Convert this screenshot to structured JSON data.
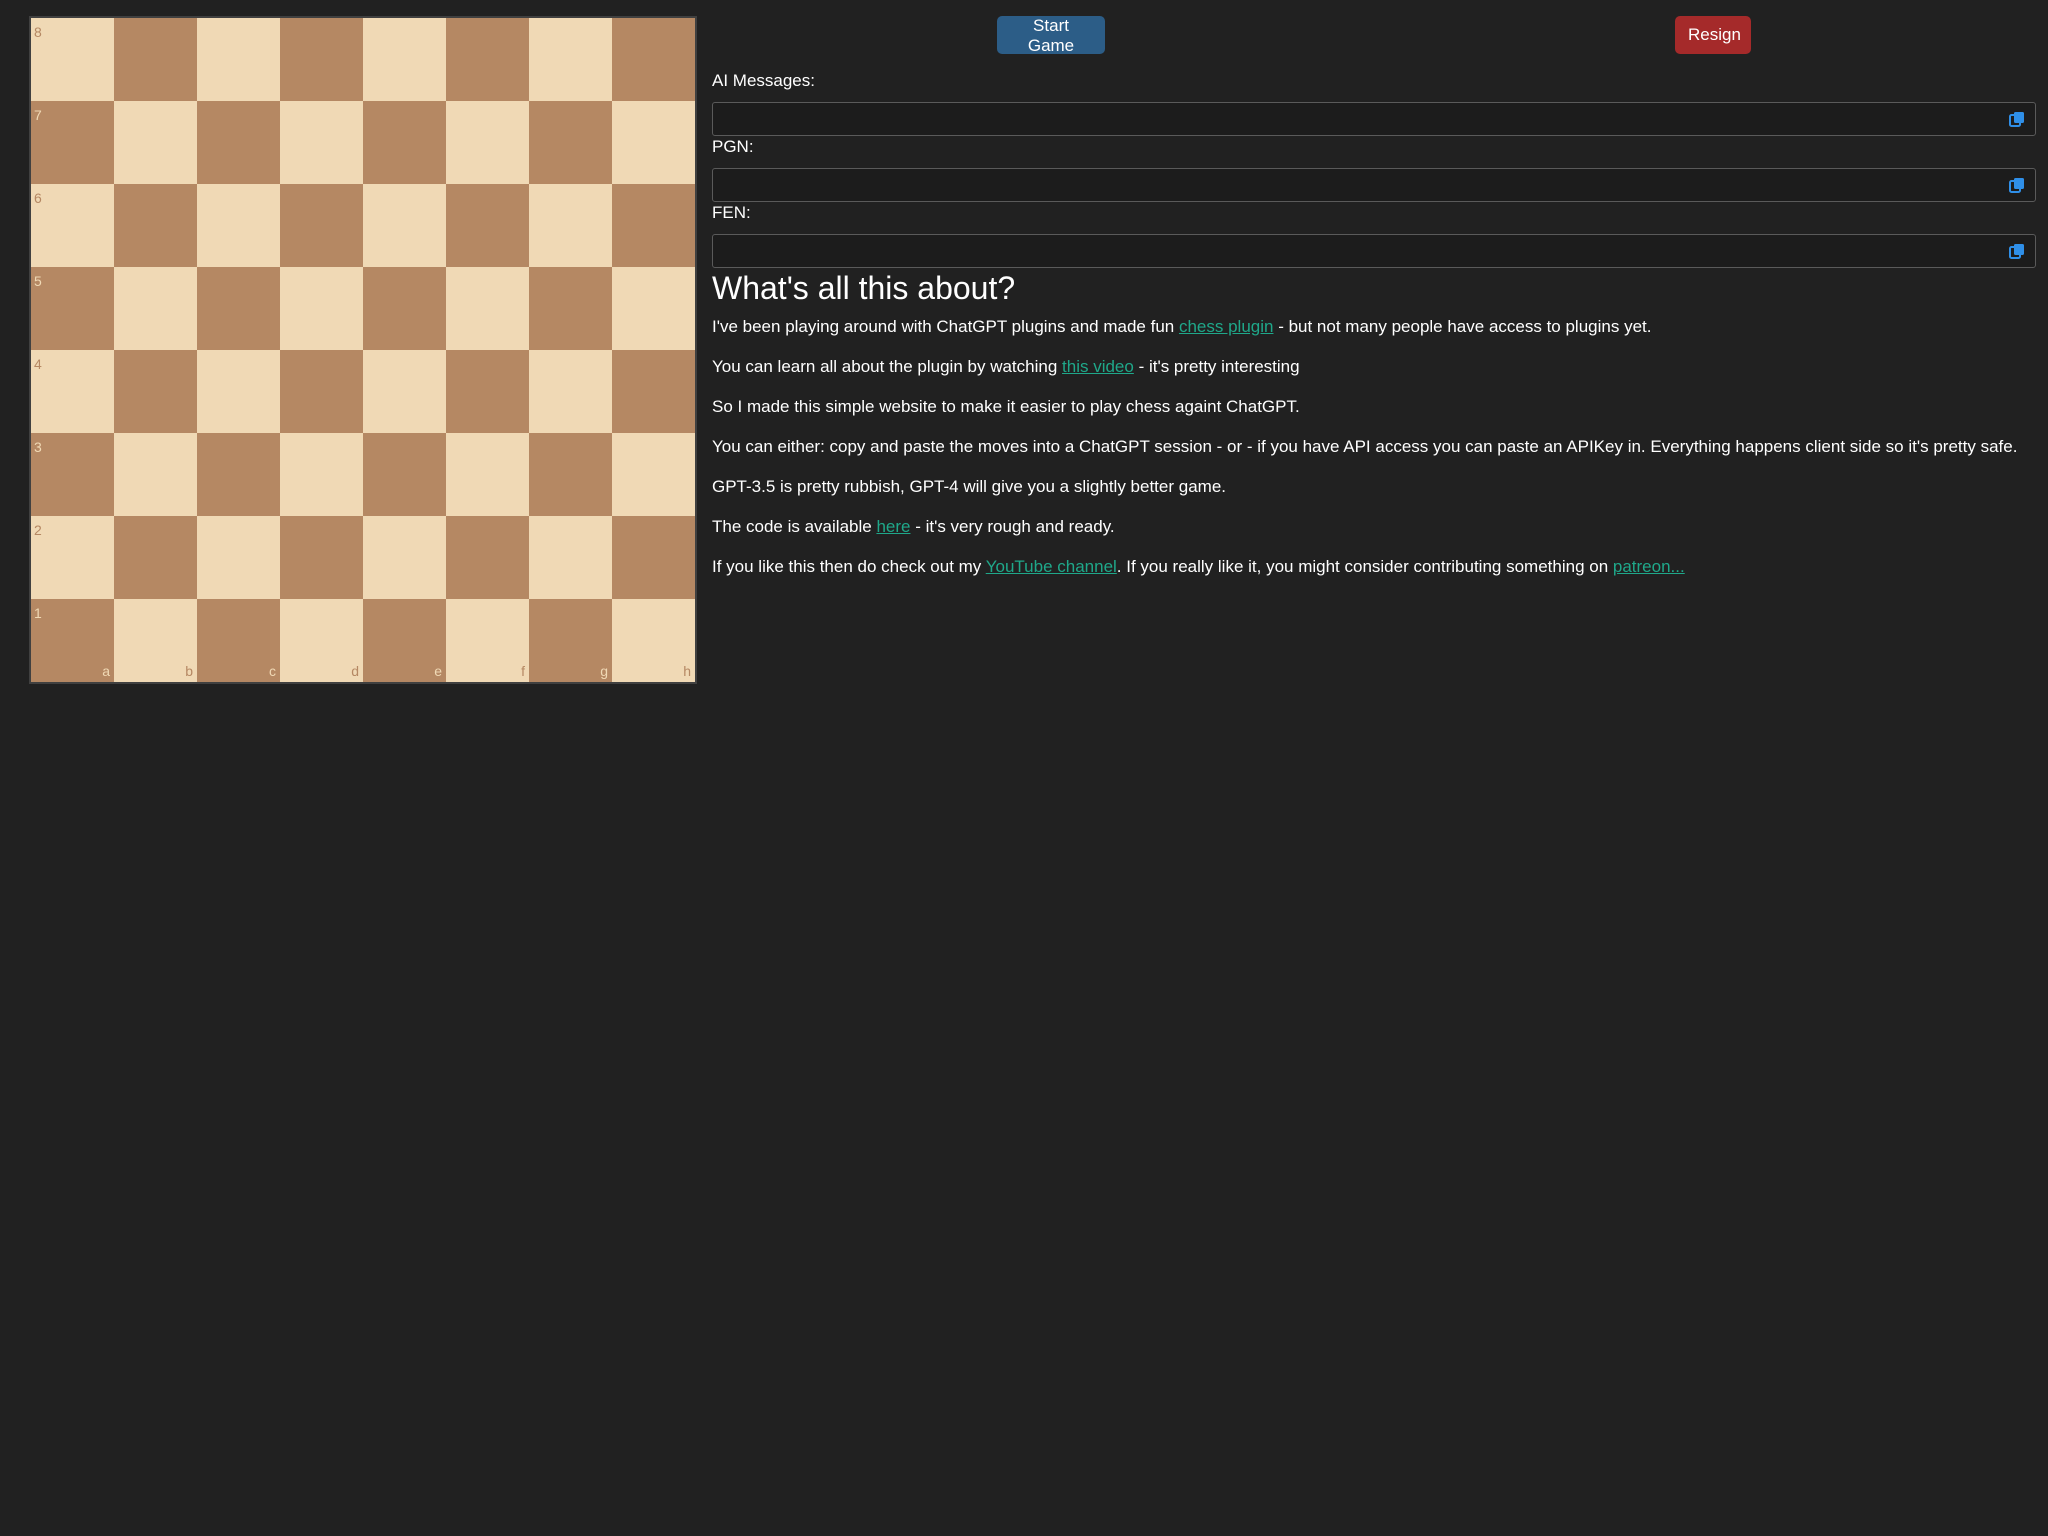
{
  "board": {
    "ranks": [
      "8",
      "7",
      "6",
      "5",
      "4",
      "3",
      "2",
      "1"
    ],
    "files": [
      "a",
      "b",
      "c",
      "d",
      "e",
      "f",
      "g",
      "h"
    ],
    "colors": {
      "light": "#f0d9b5",
      "dark": "#b58863"
    }
  },
  "controls": {
    "start_label": "Start Game",
    "resign_label": "Resign",
    "start_color": "#2c5d87",
    "resign_color": "#a52a2a"
  },
  "fields": {
    "ai_messages_label": "AI Messages:",
    "ai_messages_value": "",
    "pgn_label": "PGN:",
    "pgn_value": "",
    "fen_label": "FEN:",
    "fen_value": "",
    "copy_icon": "copy-icon"
  },
  "about": {
    "heading": "What's all this about?",
    "p1_before": "I've been playing around with ChatGPT plugins and made fun ",
    "p1_link": "chess plugin",
    "p1_after": " - but not many people have access to plugins yet.",
    "p2_before": "You can learn all about the plugin by watching ",
    "p2_link": "this video",
    "p2_after": " - it's pretty interesting",
    "p3": "So I made this simple website to make it easier to play chess againt ChatGPT.",
    "p4": "You can either: copy and paste the moves into a ChatGPT session - or - if you have API access you can paste an APIKey in. Everything happens client side so it's pretty safe.",
    "p5": "GPT-3.5 is pretty rubbish, GPT-4 will give you a slightly better game.",
    "p6_before": "The code is available ",
    "p6_link": "here",
    "p6_after": " - it's very rough and ready.",
    "p7_before": "If you like this then do check out my ",
    "p7_link1": "YouTube channel",
    "p7_middle": ". If you really like it, you might consider contributing something on ",
    "p7_link2": "patreon...",
    "link_color": "#1fa88a"
  }
}
